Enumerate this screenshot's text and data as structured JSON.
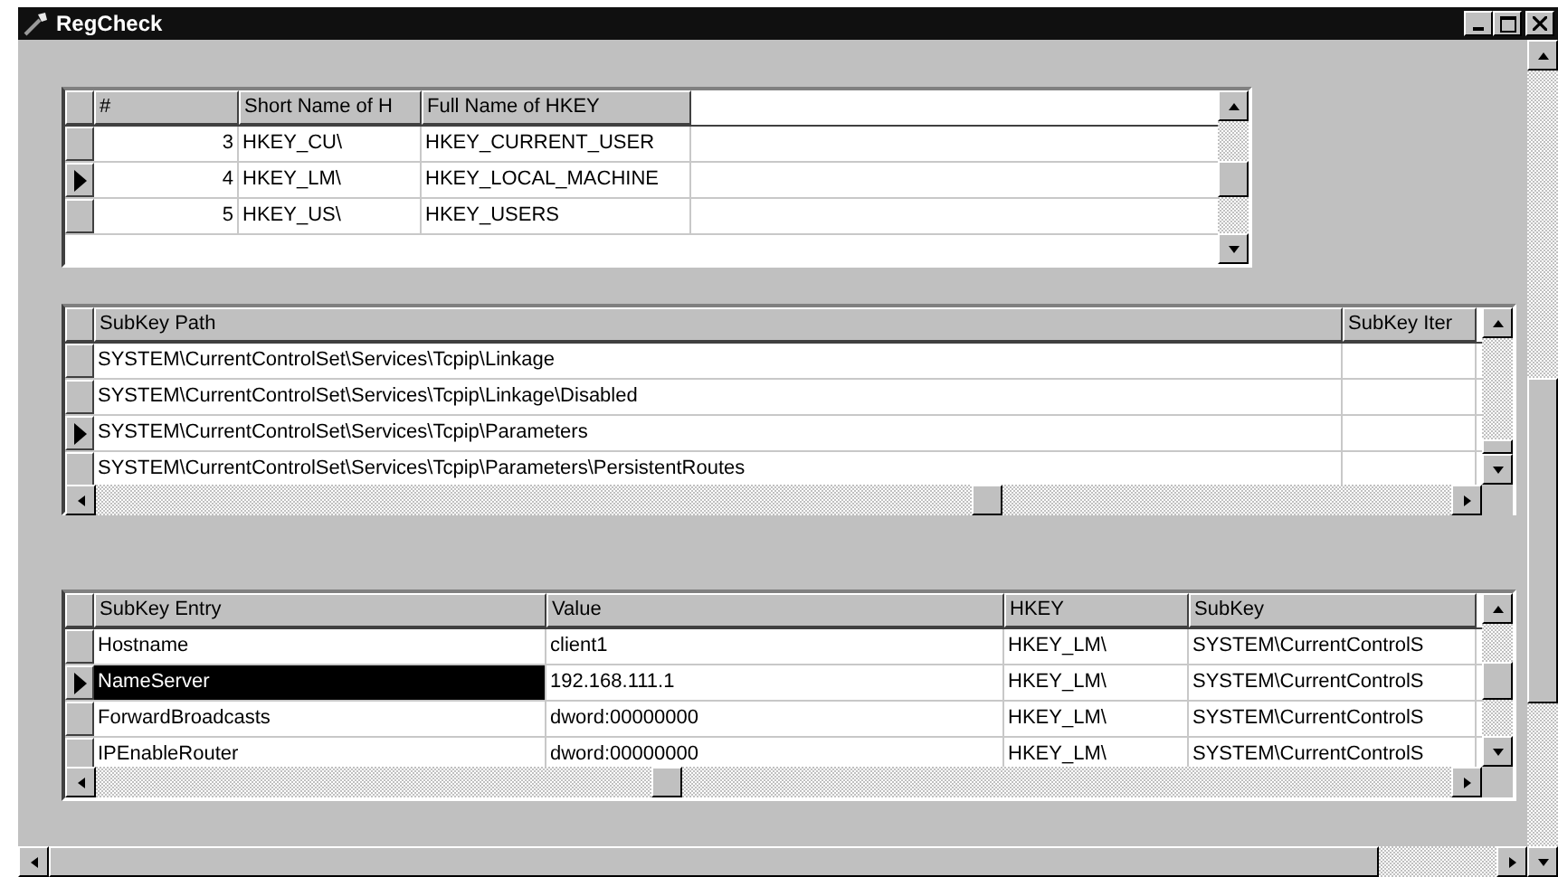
{
  "window": {
    "title": "RegCheck"
  },
  "grids": [
    {
      "columns": [
        {
          "label": "#",
          "kind": "number"
        },
        {
          "label": "Short Name of H",
          "kind": "text"
        },
        {
          "label": "Full Name of HKEY",
          "kind": "text"
        }
      ],
      "rows": [
        {
          "cells": [
            "3",
            "HKEY_CU\\",
            "HKEY_CURRENT_USER"
          ],
          "selected": false
        },
        {
          "cells": [
            "4",
            "HKEY_LM\\",
            "HKEY_LOCAL_MACHINE"
          ],
          "selected": true
        },
        {
          "cells": [
            "5",
            "HKEY_US\\",
            "HKEY_USERS"
          ],
          "selected": false
        }
      ]
    },
    {
      "columns": [
        {
          "label": "SubKey Path",
          "kind": "text"
        },
        {
          "label": "SubKey Iter",
          "kind": "text"
        }
      ],
      "rows": [
        {
          "cells": [
            "SYSTEM\\CurrentControlSet\\Services\\Tcpip\\Linkage",
            ""
          ],
          "selected": false
        },
        {
          "cells": [
            "SYSTEM\\CurrentControlSet\\Services\\Tcpip\\Linkage\\Disabled",
            ""
          ],
          "selected": false
        },
        {
          "cells": [
            "SYSTEM\\CurrentControlSet\\Services\\Tcpip\\Parameters",
            ""
          ],
          "selected": true
        },
        {
          "cells": [
            "SYSTEM\\CurrentControlSet\\Services\\Tcpip\\Parameters\\PersistentRoutes",
            ""
          ],
          "selected": false
        }
      ]
    },
    {
      "columns": [
        {
          "label": "SubKey Entry",
          "kind": "text"
        },
        {
          "label": "Value",
          "kind": "text"
        },
        {
          "label": "HKEY",
          "kind": "text"
        },
        {
          "label": "SubKey",
          "kind": "text"
        }
      ],
      "cell_highlight": true,
      "rows": [
        {
          "cells": [
            "Hostname",
            "client1",
            "HKEY_LM\\",
            "SYSTEM\\CurrentControlS"
          ],
          "selected": false
        },
        {
          "cells": [
            "NameServer",
            "192.168.111.1",
            "HKEY_LM\\",
            "SYSTEM\\CurrentControlS"
          ],
          "selected": true
        },
        {
          "cells": [
            "ForwardBroadcasts",
            "dword:00000000",
            "HKEY_LM\\",
            "SYSTEM\\CurrentControlS"
          ],
          "selected": false
        },
        {
          "cells": [
            "IPEnableRouter",
            "dword:00000000",
            "HKEY_LM\\",
            "SYSTEM\\CurrentControlS"
          ],
          "selected": false
        }
      ]
    }
  ]
}
